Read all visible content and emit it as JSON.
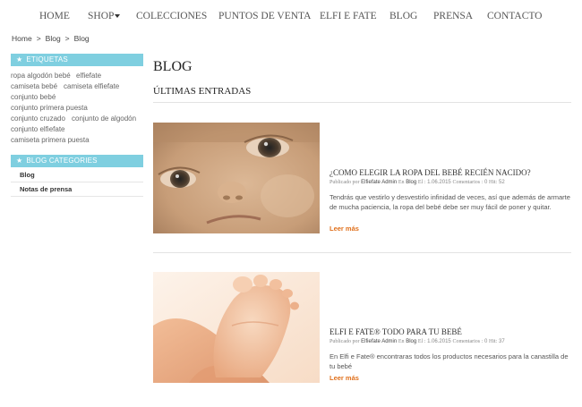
{
  "nav": {
    "items": [
      "HOME",
      "SHOP",
      "COLECCIONES",
      "PUNTOS DE VENTA",
      "ELFI E FATE",
      "BLOG",
      "PRENSA",
      "CONTACTO"
    ]
  },
  "breadcrumb": [
    "Home",
    "Blog",
    "Blog"
  ],
  "breadcrumb_sep": ">",
  "sidebar": {
    "tags_title": "ETIQUETAS",
    "tags": [
      "ropa algodón bebé",
      "elfiefate",
      "camiseta bebé",
      "camiseta elfiefate",
      "conjunto bebé",
      "conjunto primera puesta",
      "conjunto cruzado",
      "conjunto de algodón",
      "conjunto elfiefate",
      "camiseta primera puesta"
    ],
    "categories_title": "BLOG CATEGORIES",
    "categories": [
      "Blog",
      "Notas de prensa"
    ],
    "icon": "star-icon"
  },
  "main": {
    "title": "BLOG",
    "section_title": "ÚLTIMAS ENTRADAS",
    "posts": [
      {
        "title": "¿COMO ELEGIR LA ROPA DEL BEBÉ RECIÉN NACIDO?",
        "meta_published_label": "Publicado por",
        "author": "Elfiefate Admin",
        "meta_in_label": "En",
        "category": "Blog",
        "meta_on_label": "El :",
        "date": "1.06.2015",
        "meta_comments_label": "Comentarios :",
        "comments": "0",
        "meta_hits_label": "Hit:",
        "hits": "52",
        "excerpt": "Tendrás que vestirlo y desvestirlo infinidad de veces, así que además de armarte de mucha paciencia, la ropa del bebé debe ser muy fácil de poner y quitar.",
        "read_more": "Leer más",
        "image": "baby-face-photo"
      },
      {
        "title": "ELFI E FATE® TODO PARA TU BEBÉ",
        "meta_published_label": "Publicado por",
        "author": "Elfiefate Admin",
        "meta_in_label": "En",
        "category": "Blog",
        "meta_on_label": "El :",
        "date": "1.06.2015",
        "meta_comments_label": "Comentarios :",
        "comments": "0",
        "meta_hits_label": "Hit:",
        "hits": "37",
        "excerpt": "En Elfi e Fate® encontraras todos los productos necesarios para la canastilla de tu bebé",
        "read_more": "Leer más",
        "image": "baby-foot-photo"
      }
    ]
  },
  "colors": {
    "sidebar_header": "#7fcfe0",
    "read_more": "#e0701c",
    "text": "#555555"
  }
}
